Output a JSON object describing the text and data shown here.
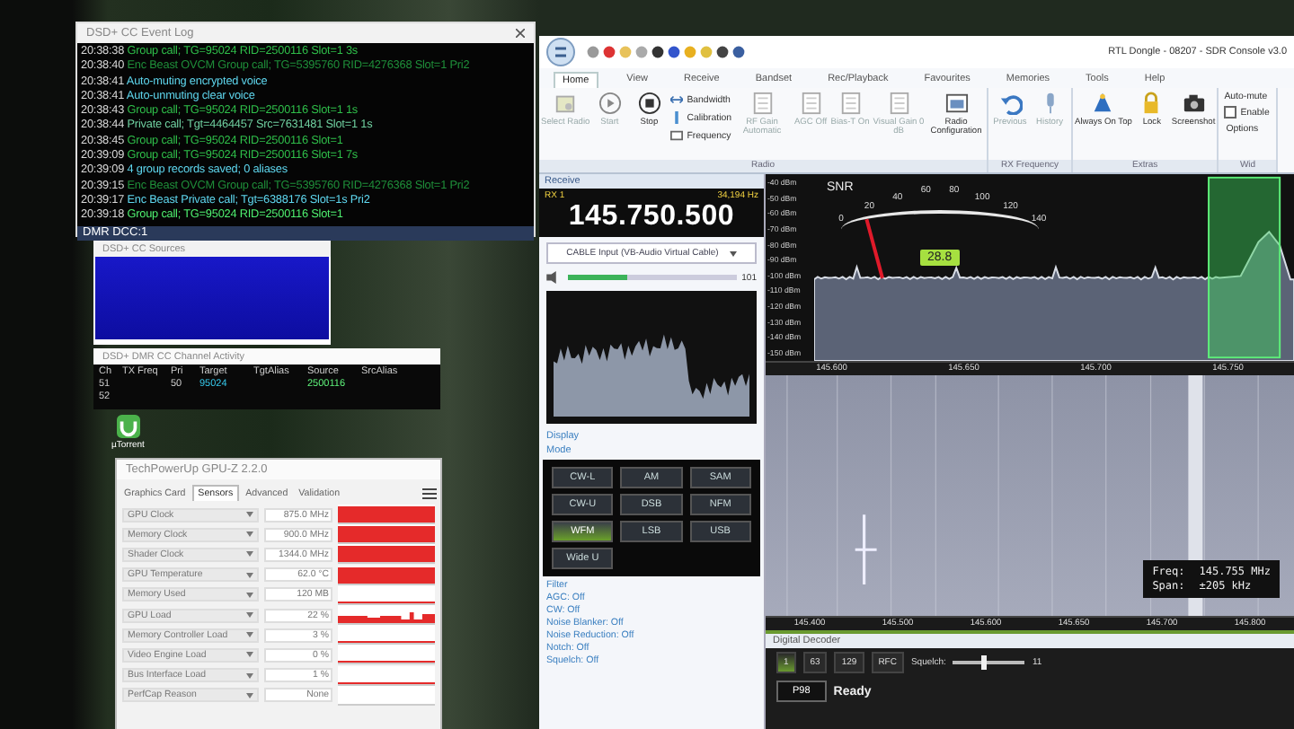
{
  "event_log": {
    "title": "DSD+ CC Event Log",
    "lines": [
      {
        "time": "20:38:38",
        "text": "Group call; TG=95024 RID=2500116 Slot=1 3s",
        "color": "#2fbf4a"
      },
      {
        "time": "20:38:40",
        "text": "Enc Beast OVCM Group call; TG=5395760 RID=4276368 Slot=1 Pri2",
        "color": "#1f8f3a"
      },
      {
        "time": "20:38:41",
        "text": "Auto-muting encrypted voice",
        "color": "#5fd8f0"
      },
      {
        "time": "20:38:41",
        "text": "Auto-unmuting clear voice",
        "color": "#5fd8f0"
      },
      {
        "time": "20:38:43",
        "text": "Group call; TG=95024 RID=2500116 Slot=1 1s",
        "color": "#2fbf4a"
      },
      {
        "time": "20:38:44",
        "text": "Private call; Tgt=4464457 Src=7631481 Slot=1 1s",
        "color": "#6fd0a0"
      },
      {
        "time": "20:38:45",
        "text": "Group call; TG=95024 RID=2500116 Slot=1",
        "color": "#2fbf4a"
      },
      {
        "time": "20:39:09",
        "text": "Group call; TG=95024 RID=2500116 Slot=1 7s",
        "color": "#2fbf4a"
      },
      {
        "time": "20:39:09",
        "text": "4 group records saved; 0 aliases",
        "color": "#5fd8f0"
      },
      {
        "time": "20:39:15",
        "text": "Enc Beast OVCM Group call; TG=5395760 RID=4276368 Slot=1 Pri2",
        "color": "#1f8f3a"
      },
      {
        "time": "20:39:17",
        "text": "Enc Beast Private call; Tgt=6388176 Slot=1s Pri2",
        "color": "#5fd8f0"
      },
      {
        "time": "20:39:18",
        "text": "Group call; TG=95024 RID=2500116 Slot=1",
        "color": "#4ff070"
      }
    ],
    "status": "DMR DCC:1"
  },
  "sources_window": {
    "title": "DSD+ CC Sources"
  },
  "channel_window": {
    "title": "DSD+ DMR CC Channel Activity",
    "columns": [
      "Ch",
      "TX Freq",
      "Pri",
      "Target",
      "TgtAlias",
      "Source",
      "SrcAlias"
    ],
    "rows": [
      {
        "ch": "51",
        "pri": "50",
        "target": "95024",
        "source": "2500116"
      },
      {
        "ch": "52"
      }
    ]
  },
  "desktop_icon": {
    "label": "µTorrent"
  },
  "gpuz": {
    "title": "TechPowerUp GPU-Z 2.2.0",
    "tabs": [
      {
        "label": "Graphics Card",
        "selected": false
      },
      {
        "label": "Sensors",
        "selected": true
      },
      {
        "label": "Advanced",
        "selected": false
      },
      {
        "label": "Validation",
        "selected": false
      }
    ],
    "sensors": [
      {
        "name": "GPU Clock",
        "value": "875.0 MHz"
      },
      {
        "name": "Memory Clock",
        "value": "900.0 MHz"
      },
      {
        "name": "Shader Clock",
        "value": "1344.0 MHz"
      },
      {
        "name": "GPU Temperature",
        "value": "62.0 °C"
      },
      {
        "name": "Memory Used",
        "value": "120 MB"
      },
      {
        "name": "GPU Load",
        "value": "22 %"
      },
      {
        "name": "Memory Controller Load",
        "value": "3 %"
      },
      {
        "name": "Video Engine Load",
        "value": "0 %"
      },
      {
        "name": "Bus Interface Load",
        "value": "1 %"
      },
      {
        "name": "PerfCap Reason",
        "value": "None"
      }
    ]
  },
  "sdr": {
    "title": "RTL Dongle - 08207 - SDR Console v3.0",
    "tabs": [
      {
        "label": "Home",
        "selected": true
      },
      {
        "label": "View",
        "selected": false
      },
      {
        "label": "Receive",
        "selected": false
      },
      {
        "label": "Bandset",
        "selected": false
      },
      {
        "label": "Rec/Playback",
        "selected": false
      },
      {
        "label": "Favourites",
        "selected": false
      },
      {
        "label": "Memories",
        "selected": false
      },
      {
        "label": "Tools",
        "selected": false
      },
      {
        "label": "Help",
        "selected": false
      }
    ],
    "groups": [
      {
        "label": "Radio",
        "buttons": [
          {
            "kind": "large",
            "label": "Select Radio",
            "disabled": true
          },
          {
            "kind": "large",
            "label": "Start",
            "disabled": true
          },
          {
            "kind": "large",
            "label": "Stop",
            "disabled": false
          },
          {
            "kind": "stack",
            "items": [
              "Bandwidth",
              "Calibration",
              "Frequency"
            ]
          },
          {
            "kind": "large",
            "label": "RF Gain Automatic",
            "disabled": true
          },
          {
            "kind": "large",
            "label": "AGC Off",
            "disabled": true
          },
          {
            "kind": "large",
            "label": "Bias-T On",
            "disabled": true
          },
          {
            "kind": "large",
            "label": "Visual Gain 0 dB",
            "disabled": true
          },
          {
            "kind": "large",
            "label": "Radio Configuration",
            "disabled": false
          }
        ]
      },
      {
        "label": "RX Frequency",
        "buttons": [
          {
            "kind": "large",
            "label": "Previous",
            "disabled": true
          },
          {
            "kind": "large",
            "label": "History",
            "disabled": true
          }
        ]
      },
      {
        "label": "Extras",
        "buttons": [
          {
            "kind": "large",
            "label": "Always On Top",
            "disabled": false
          },
          {
            "kind": "large",
            "label": "Lock",
            "disabled": false
          },
          {
            "kind": "large",
            "label": "Screenshot",
            "disabled": false
          }
        ]
      },
      {
        "label": "Wid",
        "buttons": [
          {
            "kind": "options",
            "title": "Auto-mute",
            "checkbox": "Enable",
            "checked": false,
            "option": "Options"
          }
        ]
      }
    ],
    "receive": {
      "header": "Receive",
      "rx": "RX 1",
      "offset": "34,194 Hz",
      "frequency": "145.750.500",
      "audio_input": "CABLE Input (VB-Audio Virtual Cable)",
      "volume": {
        "level": 0.35,
        "reading": "101"
      },
      "display_label": "Display",
      "mode_label": "Mode",
      "modes": [
        {
          "label": "CW-L",
          "selected": false
        },
        {
          "label": "AM",
          "selected": false
        },
        {
          "label": "SAM",
          "selected": false
        },
        {
          "label": "CW-U",
          "selected": false
        },
        {
          "label": "DSB",
          "selected": false
        },
        {
          "label": "NFM",
          "selected": false
        },
        {
          "label": "WFM",
          "selected": true
        },
        {
          "label": "LSB",
          "selected": false
        },
        {
          "label": "USB",
          "selected": false
        },
        {
          "label": "Wide U",
          "selected": false
        }
      ],
      "filters": [
        "Filter",
        "AGC: Off",
        "CW: Off",
        "Noise Blanker: Off",
        "Noise Reduction: Off",
        "Notch: Off",
        "Squelch: Off"
      ]
    },
    "spectrum": {
      "dbm_labels": [
        "-40 dBm",
        "-50 dBm",
        "-60 dBm",
        "-70 dBm",
        "-80 dBm",
        "-90 dBm",
        "-100 dBm",
        "-110 dBm",
        "-120 dBm",
        "-130 dBm",
        "-140 dBm",
        "-150 dBm"
      ],
      "meter": {
        "title": "SNR",
        "scale": [
          "0",
          "20",
          "40",
          "60",
          "80",
          "100",
          "120",
          "140"
        ],
        "value": "28.8",
        "level": 0.2
      },
      "axis": [
        "145.600",
        "145.650",
        "145.700",
        "145.750"
      ]
    },
    "waterfall": {
      "tooltip": {
        "freq_label": "Freq:",
        "freq": "145.755 MHz",
        "span_label": "Span:",
        "span": "±205 kHz"
      },
      "axis": [
        "145.400",
        "145.500",
        "145.600",
        "145.650",
        "145.700",
        "145.800"
      ]
    },
    "decoder": {
      "title": "Digital Decoder",
      "buttons": [
        {
          "label": "1",
          "selected": true
        },
        {
          "label": "63",
          "selected": false
        },
        {
          "label": "129",
          "selected": false
        }
      ],
      "rfc": "RFC",
      "squelch_label": "Squelch:",
      "squelch": {
        "level": 0.4,
        "reading": "11"
      },
      "status": "Ready",
      "slot": "P98"
    }
  }
}
